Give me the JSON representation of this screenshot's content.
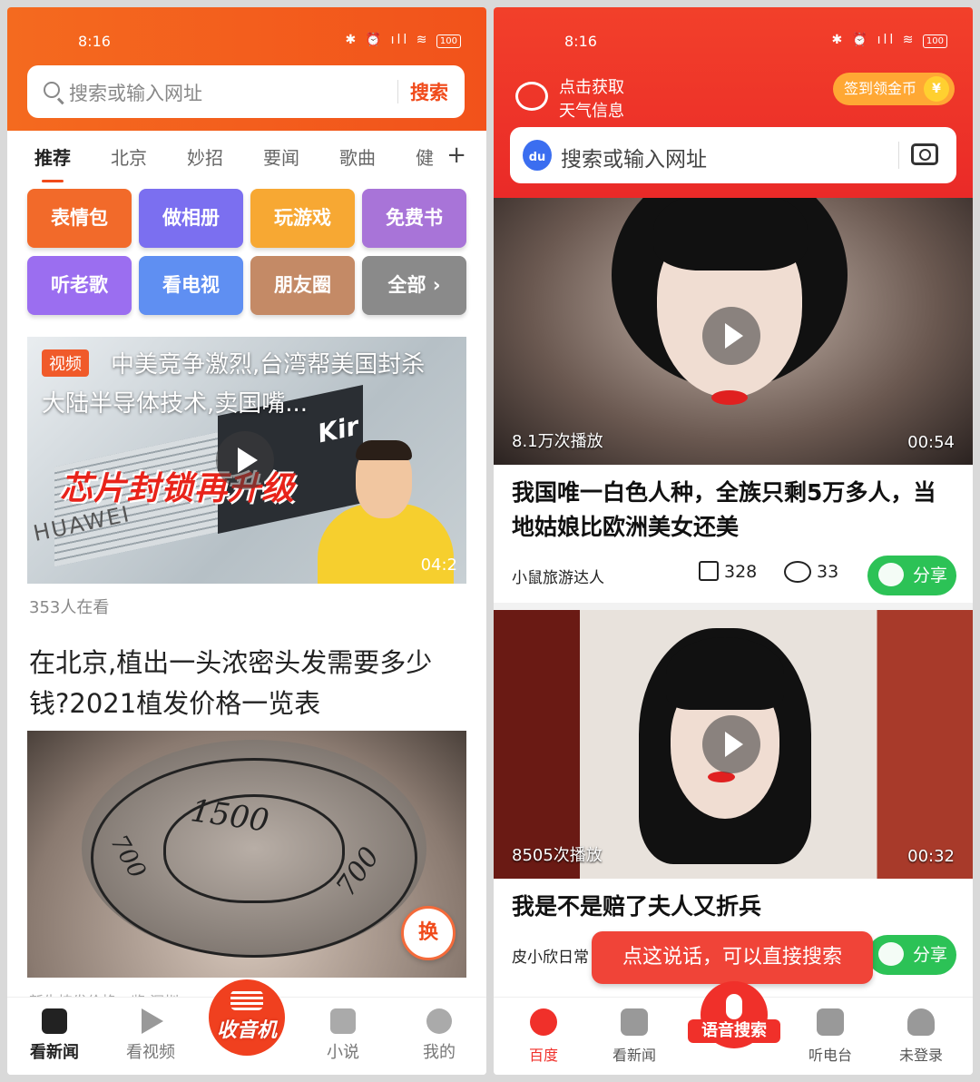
{
  "left": {
    "status": {
      "time": "8:16",
      "battery": "100"
    },
    "search": {
      "placeholder": "搜索或输入网址",
      "button": "搜索"
    },
    "tabs": [
      "推荐",
      "北京",
      "妙招",
      "要闻",
      "歌曲",
      "健"
    ],
    "grid": [
      {
        "label": "表情包",
        "color": "#f26a2a"
      },
      {
        "label": "做相册",
        "color": "#7b6ff0"
      },
      {
        "label": "玩游戏",
        "color": "#f7a833"
      },
      {
        "label": "免费书",
        "color": "#a874d8"
      },
      {
        "label": "听老歌",
        "color": "#9b6ef0"
      },
      {
        "label": "看电视",
        "color": "#5f8ff2"
      },
      {
        "label": "朋友圈",
        "color": "#c48a66"
      },
      {
        "label": "全部",
        "color": "#8a8a8a"
      }
    ],
    "video_card": {
      "tag": "视频",
      "title": "中美竞争激烈,台湾帮美国封杀大陆半导体技术,卖国嘴...",
      "overlay_text": "芯片封锁再升级",
      "chip_brand": "HUAWEI",
      "chip_logo": "Kir",
      "duration": "04:2",
      "watching": "353人在看"
    },
    "article": {
      "title": "在北京,植出一头浓密头发需要多少钱?2021植发价格一览表",
      "numbers": [
        "1500",
        "700",
        "700"
      ],
      "swap_label": "换",
      "peek": "新生植发价格一览  深圳"
    },
    "tabbar": [
      "看新闻",
      "看视频",
      "收音机",
      "小说",
      "我的"
    ]
  },
  "right": {
    "status": {
      "time": "8:16",
      "battery": "100"
    },
    "weather": [
      "点击获取",
      "天气信息"
    ],
    "coin": {
      "label": "签到领金币",
      "symbol": "¥"
    },
    "search": {
      "placeholder": "搜索或输入网址",
      "logo": "du"
    },
    "feed": [
      {
        "views": "8.1万次播放",
        "duration": "00:54",
        "title": "我国唯一白色人种，全族只剩5万多人，当地姑娘比欧洲美女还美",
        "author": "小鼠旅游达人",
        "likes": "328",
        "comments": "33",
        "share": "分享"
      },
      {
        "views": "8505次播放",
        "duration": "00:32",
        "title": "我是不是赔了夫人又折兵",
        "author": "皮小欣日常",
        "share": "分享"
      }
    ],
    "tooltip": "点这说话，可以直接搜索",
    "tabbar": [
      "百度",
      "看新闻",
      "语音搜索",
      "听电台",
      "未登录"
    ]
  }
}
